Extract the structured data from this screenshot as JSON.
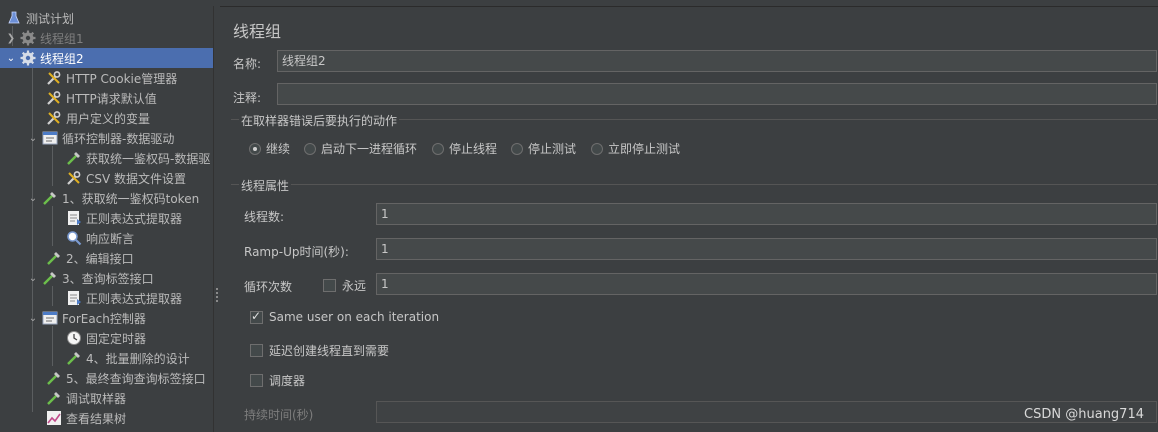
{
  "tree": {
    "items": [
      {
        "label": "测试计划",
        "icon": "flask-icon"
      },
      {
        "label": "线程组1",
        "icon": "gear-icon"
      },
      {
        "label": "线程组2",
        "icon": "gear-icon"
      },
      {
        "label": "HTTP Cookie管理器",
        "icon": "wrench-icon"
      },
      {
        "label": "HTTP请求默认值",
        "icon": "wrench-icon"
      },
      {
        "label": "用户定义的变量",
        "icon": "wrench-icon"
      },
      {
        "label": "循环控制器-数据驱动",
        "icon": "controller-icon"
      },
      {
        "label": "获取统一鉴权码-数据驱",
        "icon": "pipette-icon"
      },
      {
        "label": "CSV 数据文件设置",
        "icon": "wrench-icon"
      },
      {
        "label": "1、获取统一鉴权码token",
        "icon": "pipette-icon"
      },
      {
        "label": "正则表达式提取器",
        "icon": "extractor-icon"
      },
      {
        "label": "响应断言",
        "icon": "magnifier-icon"
      },
      {
        "label": "2、编辑接口",
        "icon": "pipette-icon"
      },
      {
        "label": "3、查询标签接口",
        "icon": "pipette-icon"
      },
      {
        "label": "正则表达式提取器",
        "icon": "extractor-icon"
      },
      {
        "label": "ForEach控制器",
        "icon": "controller-icon"
      },
      {
        "label": "固定定时器",
        "icon": "timer-icon"
      },
      {
        "label": "4、批量删除的设计",
        "icon": "pipette-icon"
      },
      {
        "label": "5、最终查询查询标签接口",
        "icon": "pipette-icon"
      },
      {
        "label": "调试取样器",
        "icon": "pipette-icon"
      },
      {
        "label": "查看结果树",
        "icon": "chart-icon"
      }
    ]
  },
  "panel": {
    "title": "线程组",
    "name_label": "名称:",
    "name_value": "线程组2",
    "comment_label": "注释:",
    "comment_value": "",
    "error_action": {
      "title": "在取样器错误后要执行的动作",
      "options": [
        "继续",
        "启动下一进程循环",
        "停止线程",
        "停止测试",
        "立即停止测试"
      ],
      "selected": "继续"
    },
    "thread_props": {
      "title": "线程属性",
      "threads_label": "线程数:",
      "threads_value": "1",
      "rampup_label": "Ramp-Up时间(秒):",
      "rampup_value": "1",
      "loop_label": "循环次数",
      "forever_label": "永远",
      "loop_value": "1",
      "same_user_label": "Same user on each iteration",
      "same_user_checked": true,
      "delay_label": "延迟创建线程直到需要",
      "scheduler_label": "调度器",
      "duration_label": "持续时间(秒)",
      "duration_value": ""
    }
  },
  "watermark": "CSDN @huang714",
  "colors": {
    "selected": "#4b6eaf",
    "background": "#3c3f41",
    "field": "#45494a"
  }
}
